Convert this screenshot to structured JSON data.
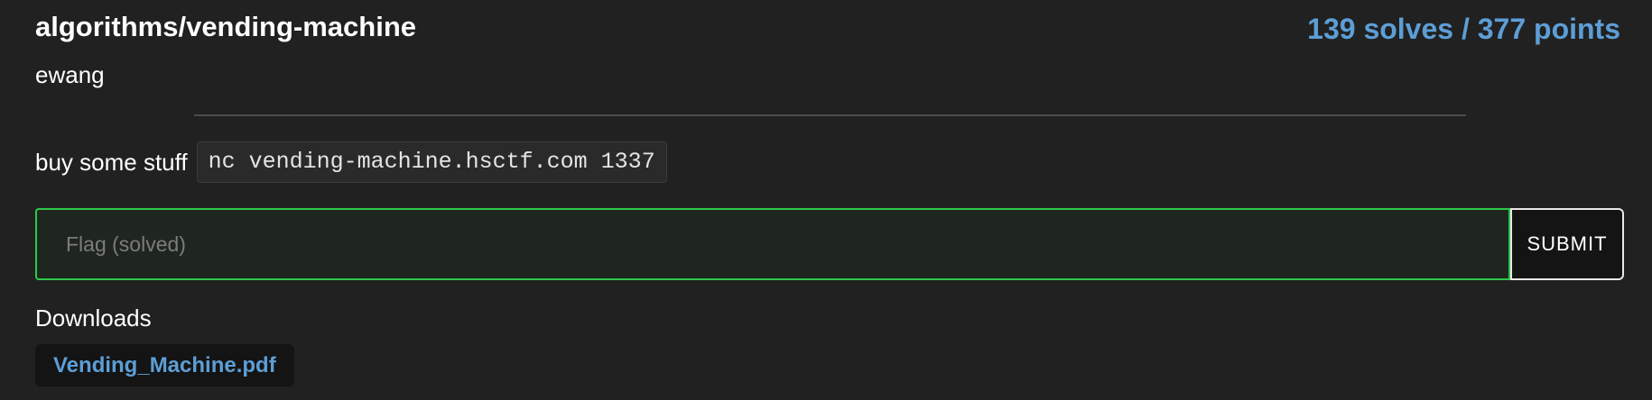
{
  "challenge": {
    "title": "algorithms/vending-machine",
    "stats": "139 solves / 377 points",
    "author": "ewang",
    "description": "buy some stuff",
    "code": "nc vending-machine.hsctf.com 1337"
  },
  "flag_form": {
    "placeholder": "Flag (solved)",
    "value": "",
    "submit_label": "SUBMIT"
  },
  "downloads": {
    "heading": "Downloads",
    "files": [
      "Vending_Machine.pdf"
    ]
  },
  "colors": {
    "background": "#212121",
    "accent_blue": "#5d9ed6",
    "solved_green": "#2ec84a"
  }
}
